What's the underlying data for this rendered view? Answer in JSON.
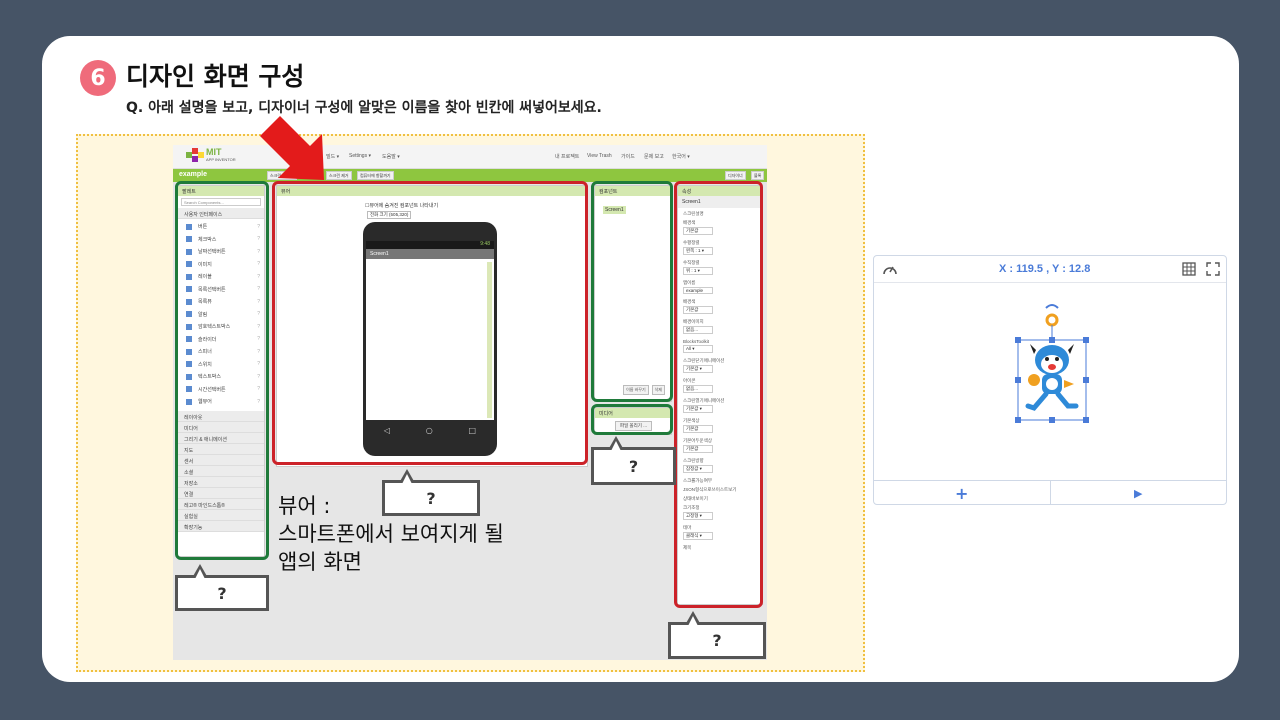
{
  "slide": {
    "step_number": "6",
    "title": "디자인 화면 구성",
    "question": "Q. 아래 설명을 보고, 디자이너 구성에 알맞은 이름을 찾아 빈칸에  써넣어보세요."
  },
  "app_inventor": {
    "logo_mit": "MIT",
    "logo_sub": "APP INVENTOR",
    "menus": [
      "빌드 ▾",
      "Settings ▾",
      "도움말 ▾"
    ],
    "right_menus": [
      "내 프로젝트",
      "View Trash",
      "가이드",
      "문제 보고",
      "한국어 ▾"
    ],
    "project_name": "example",
    "bar_buttons": [
      "스크린 추가",
      "스크린 제거",
      "컴퓨터에 향할까기"
    ],
    "bar_right": [
      "디자이너",
      "블록"
    ],
    "palette": {
      "title": "팔레트",
      "search_placeholder": "Search Components...",
      "category_ui": "사용자 인터페이스",
      "items": [
        "버튼",
        "체크박스",
        "날짜선택버튼",
        "이미지",
        "레이블",
        "목록선택버튼",
        "목록뷰",
        "알림",
        "암호텍스트박스",
        "슬라이더",
        "스피너",
        "스위치",
        "텍스트박스",
        "시간선택버튼",
        "웹뷰어"
      ],
      "categories": [
        "레이아웃",
        "미디어",
        "그리기 & 애니메이션",
        "지도",
        "센서",
        "소셜",
        "저장소",
        "연결",
        "레고® 마인드스톰®",
        "실험실",
        "확장기능"
      ]
    },
    "viewer": {
      "title": "뷰어",
      "checkbox_label": "뷰어에 숨겨진 컴포넌트 나타내기",
      "size_select": "전화 크기 (505,320)",
      "screen_title": "Screen1",
      "time": "9:48"
    },
    "components": {
      "title": "컴포넌트",
      "screen": "Screen1",
      "rename": "이름 바꾸기",
      "delete": "삭제"
    },
    "media": {
      "title": "미디어",
      "upload": "파일 올리기 ..."
    },
    "properties": {
      "title": "속성",
      "screen": "Screen1",
      "items": [
        {
          "label": "스크린설명",
          "value": ""
        },
        {
          "label": "배경색",
          "value": "기본값"
        },
        {
          "label": "수평정렬",
          "value": "왼쪽 : 1 ▾"
        },
        {
          "label": "수직정렬",
          "value": "위 : 1 ▾"
        },
        {
          "label": "앱이름",
          "value": "example"
        },
        {
          "label": "배경색",
          "value": "기본값"
        },
        {
          "label": "배경이미지",
          "value": "없음..."
        },
        {
          "label": "BlocksToolkit",
          "value": "All ▾"
        },
        {
          "label": "스크린닫기애니메이션",
          "value": "기본값 ▾"
        },
        {
          "label": "아이콘",
          "value": "없음..."
        },
        {
          "label": "스크린열기애니메이션",
          "value": "기본값 ▾"
        },
        {
          "label": "기본색상",
          "value": "기본값"
        },
        {
          "label": "기본어두운색상",
          "value": "기본값"
        },
        {
          "label": "스크린방향",
          "value": "잠정값 ▾"
        },
        {
          "label": "스크롤가능여부",
          "value": ""
        },
        {
          "label": "JSON형식으로쓰이스트보기",
          "value": ""
        },
        {
          "label": "상태바보이기",
          "value": ""
        },
        {
          "label": "크기조정",
          "value": "고정형 ▾"
        },
        {
          "label": "테마",
          "value": "클래식 ▾"
        },
        {
          "label": "제목",
          "value": ""
        }
      ],
      "colors": {
        "primary": "#3f51b5",
        "primary_dark": "#303f9f",
        "accent": "#ff4081"
      }
    }
  },
  "annotations": {
    "callout_mark": "?",
    "viewer_text_line1": "뷰어 :",
    "viewer_text_line2": "스마트폰에서 보여지게 될",
    "viewer_text_line3": "앱의 화면",
    "green": "#1f7a3a",
    "red": "#cc2229"
  },
  "preview": {
    "coords": "X : 119.5 , Y : 12.8"
  }
}
